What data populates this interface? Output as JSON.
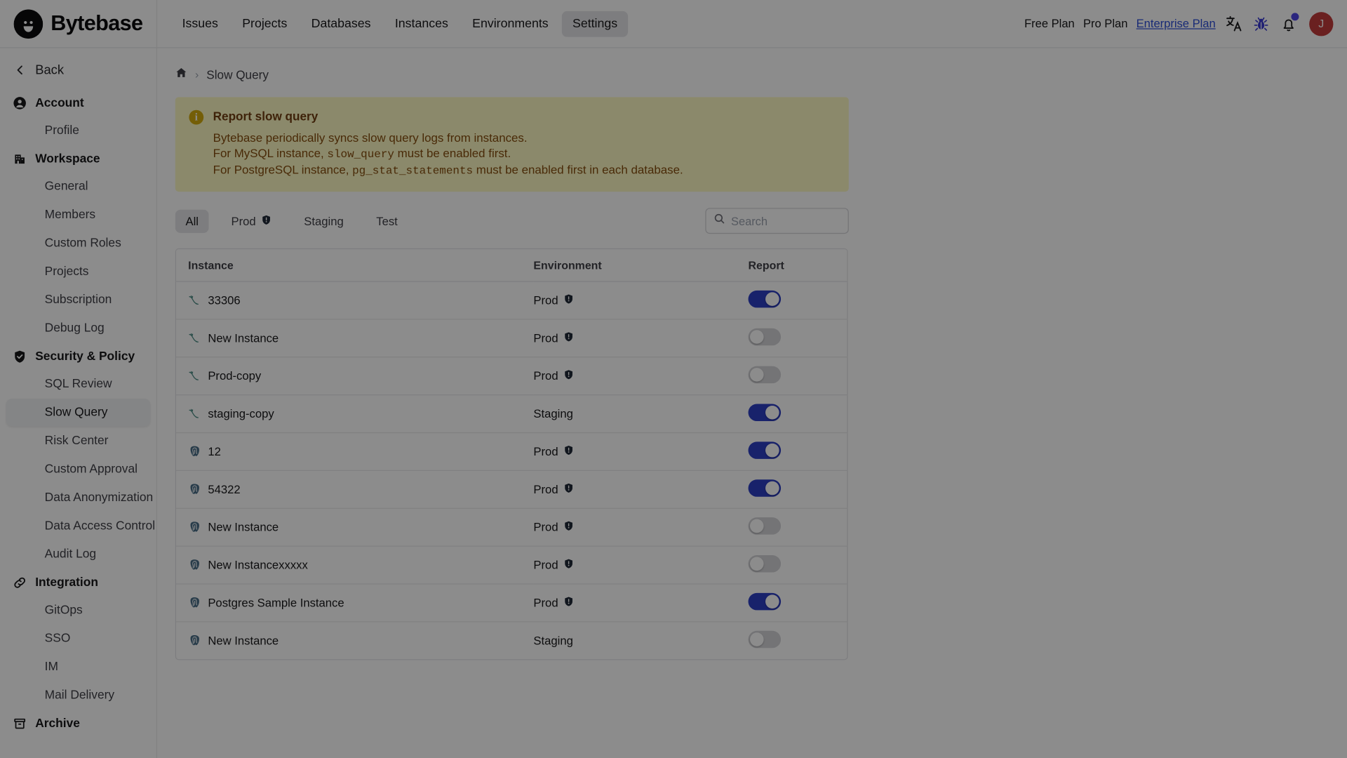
{
  "brand": {
    "name": "Bytebase",
    "logo_icon": "bytebase-logo-icon"
  },
  "topnav": {
    "items": [
      {
        "label": "Issues",
        "active": false
      },
      {
        "label": "Projects",
        "active": false
      },
      {
        "label": "Databases",
        "active": false
      },
      {
        "label": "Instances",
        "active": false
      },
      {
        "label": "Environments",
        "active": false
      },
      {
        "label": "Settings",
        "active": true
      }
    ]
  },
  "topright": {
    "free_plan": "Free Plan",
    "pro_plan": "Pro Plan",
    "enterprise_plan": "Enterprise Plan",
    "language_icon": "translate-icon",
    "debug_icon": "bug-icon",
    "notification_icon": "bell-icon",
    "avatar_initial": "J",
    "avatar_color": "#c23b3b",
    "link_color": "#2d4ed8"
  },
  "sidebar": {
    "back_label": "Back",
    "sections": [
      {
        "label": "Account",
        "icon": "user-circle-icon",
        "items": [
          {
            "label": "Profile",
            "active": false
          }
        ]
      },
      {
        "label": "Workspace",
        "icon": "building-icon",
        "items": [
          {
            "label": "General",
            "active": false
          },
          {
            "label": "Members",
            "active": false
          },
          {
            "label": "Custom Roles",
            "active": false
          },
          {
            "label": "Projects",
            "active": false
          },
          {
            "label": "Subscription",
            "active": false
          },
          {
            "label": "Debug Log",
            "active": false
          }
        ]
      },
      {
        "label": "Security & Policy",
        "icon": "shield-check-icon",
        "items": [
          {
            "label": "SQL Review",
            "active": false
          },
          {
            "label": "Slow Query",
            "active": true
          },
          {
            "label": "Risk Center",
            "active": false
          },
          {
            "label": "Custom Approval",
            "active": false
          },
          {
            "label": "Data Anonymization",
            "active": false
          },
          {
            "label": "Data Access Control",
            "active": false
          },
          {
            "label": "Audit Log",
            "active": false
          }
        ]
      },
      {
        "label": "Integration",
        "icon": "link-icon",
        "items": [
          {
            "label": "GitOps",
            "active": false
          },
          {
            "label": "SSO",
            "active": false
          },
          {
            "label": "IM",
            "active": false
          },
          {
            "label": "Mail Delivery",
            "active": false
          }
        ]
      },
      {
        "label": "Archive",
        "icon": "archive-icon",
        "items": []
      }
    ]
  },
  "breadcrumb": {
    "home_icon": "home-icon",
    "separator": "›",
    "current": "Slow Query"
  },
  "alert": {
    "icon": "info-circle-icon",
    "title": "Report slow query",
    "lines": [
      {
        "pre": "Bytebase periodically syncs slow query logs from instances.",
        "code": "",
        "post": ""
      },
      {
        "pre": "For MySQL instance, ",
        "code": "slow_query",
        "post": " must be enabled first."
      },
      {
        "pre": "For PostgreSQL instance, ",
        "code": "pg_stat_statements",
        "post": " must be enabled first in each database."
      }
    ],
    "bg_color": "#fef9c3",
    "text_color": "#854d0e"
  },
  "filters": {
    "tabs": [
      {
        "label": "All",
        "active": true,
        "has_shield": false
      },
      {
        "label": "Prod",
        "active": false,
        "has_shield": true
      },
      {
        "label": "Staging",
        "active": false,
        "has_shield": false
      },
      {
        "label": "Test",
        "active": false,
        "has_shield": false
      }
    ],
    "search": {
      "placeholder": "Search",
      "value": "",
      "icon": "search-icon"
    }
  },
  "table": {
    "columns": [
      "Instance",
      "Environment",
      "Report"
    ],
    "rows": [
      {
        "instance": "33306",
        "engine": "mysql",
        "environment": "Prod",
        "env_shield": true,
        "report": true
      },
      {
        "instance": "New Instance",
        "engine": "mysql",
        "environment": "Prod",
        "env_shield": true,
        "report": false
      },
      {
        "instance": "Prod-copy",
        "engine": "mysql",
        "environment": "Prod",
        "env_shield": true,
        "report": false
      },
      {
        "instance": "staging-copy",
        "engine": "mysql",
        "environment": "Staging",
        "env_shield": false,
        "report": true
      },
      {
        "instance": "12",
        "engine": "postgres",
        "environment": "Prod",
        "env_shield": true,
        "report": true
      },
      {
        "instance": "54322",
        "engine": "postgres",
        "environment": "Prod",
        "env_shield": true,
        "report": true
      },
      {
        "instance": "New Instance",
        "engine": "postgres",
        "environment": "Prod",
        "env_shield": true,
        "report": false
      },
      {
        "instance": "New Instancexxxxx",
        "engine": "postgres",
        "environment": "Prod",
        "env_shield": true,
        "report": false
      },
      {
        "instance": "Postgres Sample Instance",
        "engine": "postgres",
        "environment": "Prod",
        "env_shield": true,
        "report": true
      },
      {
        "instance": "New Instance",
        "engine": "postgres",
        "environment": "Staging",
        "env_shield": false,
        "report": false
      }
    ],
    "toggle_on_color": "#2d3ec4",
    "toggle_off_color": "#d4d4d8"
  }
}
